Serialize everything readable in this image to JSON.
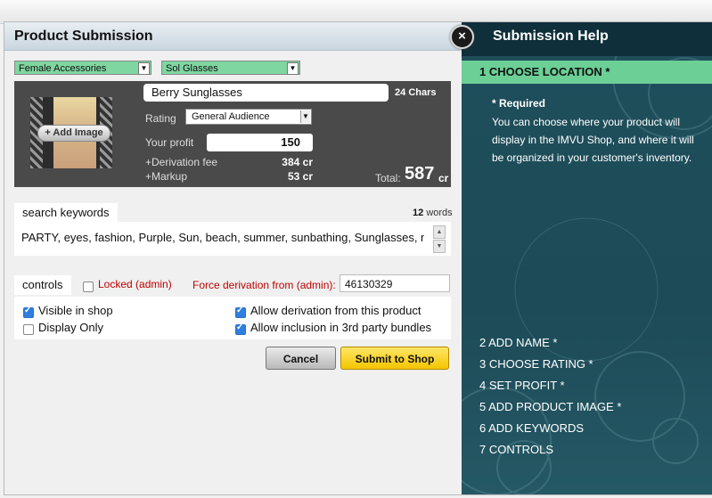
{
  "dialog": {
    "title": "Product Submission",
    "close_symbol": "×"
  },
  "location": {
    "category": "Female Accessories",
    "subcategory": "Sol Glasses"
  },
  "product": {
    "add_image_label": "Add Image",
    "name_value": "Berry Sunglasses",
    "chars_count": "24",
    "chars_label": "Chars",
    "rating_label": "Rating",
    "rating_value": "General Audience",
    "profit_label": "Your profit",
    "profit_value": "150",
    "derivation_fee_label": "+Derivation fee",
    "derivation_fee_value": "384 cr",
    "markup_label": "+Markup",
    "markup_value": "53 cr",
    "total_label": "Total:",
    "total_value": "587",
    "total_unit": "cr"
  },
  "keywords": {
    "tab_label": "search keywords",
    "count": "12",
    "count_label": "words",
    "text": "PARTY, eyes, fashion, Purple, Sun, beach, summer, sunbathing, Sunglasses, magenta, accessory, mulberry"
  },
  "controls": {
    "tab_label": "controls",
    "locked_label": "Locked (admin)",
    "locked_checked": false,
    "force_derivation_label": "Force derivation from (admin):",
    "force_derivation_value": "46130329",
    "visible_label": "Visible in shop",
    "visible_checked": true,
    "display_only_label": "Display Only",
    "display_only_checked": false,
    "allow_derivation_label": "Allow derivation from this product",
    "allow_derivation_checked": true,
    "allow_inclusion_label": "Allow inclusion in 3rd party bundles",
    "allow_inclusion_checked": true
  },
  "buttons": {
    "cancel": "Cancel",
    "submit": "Submit to Shop"
  },
  "help": {
    "title": "Submission Help",
    "active_step": "1  CHOOSE LOCATION *",
    "required_note": "* Required",
    "description": "You can choose where your product will display in the IMVU Shop, and where it will be organized in your customer's inventory.",
    "steps": [
      "2  ADD NAME *",
      "3  CHOOSE RATING *",
      "4  SET PROFIT *",
      "5  ADD PRODUCT IMAGE *",
      "6  ADD KEYWORDS",
      "7  CONTROLS"
    ]
  },
  "colors": {
    "help_background": "#1f4f5c",
    "active_step": "#6ccf96",
    "submit_button": "#f9d626",
    "dropdown_green": "#7fd6a0"
  }
}
